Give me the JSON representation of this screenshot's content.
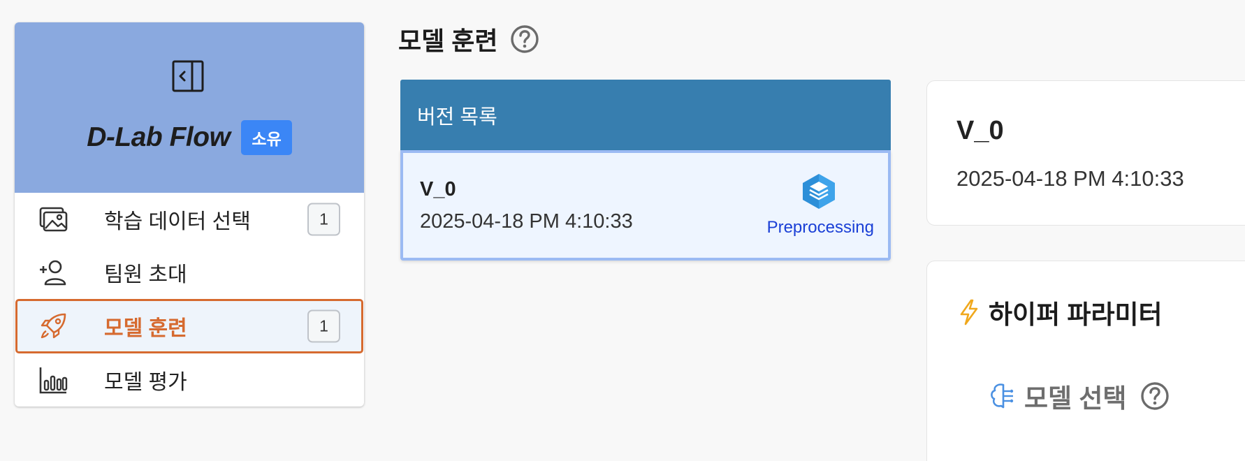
{
  "sidebar": {
    "brand": "D-Lab Flow",
    "badge": "소유",
    "items": [
      {
        "label": "학습 데이터 선택",
        "icon": "images-icon",
        "count": "1"
      },
      {
        "label": "팀원 초대",
        "icon": "user-plus-icon",
        "count": ""
      },
      {
        "label": "모델 훈련",
        "icon": "rocket-icon",
        "count": "1",
        "active": true
      },
      {
        "label": "모델 평가",
        "icon": "bar-chart-icon",
        "count": ""
      }
    ]
  },
  "page": {
    "title": "모델 훈련"
  },
  "version_list": {
    "header": "버전 목록",
    "versions": [
      {
        "name": "V_0",
        "date": "2025-04-18 PM 4:10:33",
        "status": "Preprocessing"
      }
    ]
  },
  "detail": {
    "name": "V_0",
    "date": "2025-04-18 PM 4:10:33"
  },
  "hyperparams": {
    "title": "하이퍼 파라미터",
    "model_select_label": "모델 선택"
  },
  "colors": {
    "sidebar_header": "#8aa9df",
    "brand_badge": "#3b86f6",
    "active_nav": "#d66a2f",
    "list_header": "#377eaf",
    "card_border": "#9bbaf3",
    "status_text": "#1a3fd6"
  }
}
